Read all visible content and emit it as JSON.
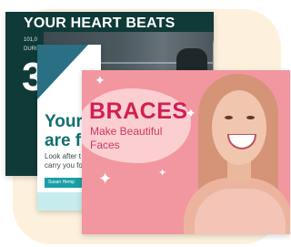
{
  "cards": {
    "heart": {
      "title": "YOUR HEART BEATS",
      "meta_line1": "101,0",
      "meta_line2": "DURIN",
      "big_number": "3"
    },
    "your": {
      "title_line1": "Your",
      "title_line2": "are fo",
      "text_line1": "Look after t",
      "text_line2": "carry you fo",
      "button_label": "Susan Hemp"
    },
    "braces": {
      "title": "BRACES",
      "subtitle": "Make Beautiful Faces",
      "sparkle_glyph": "✦"
    }
  },
  "colors": {
    "heart_bg": "#0f3a37",
    "your_accent": "#126f70",
    "braces_bg": "#f2979f",
    "braces_title": "#d01f54",
    "glow": "#fdf1de"
  },
  "icons": [
    "sparkle-icon"
  ]
}
